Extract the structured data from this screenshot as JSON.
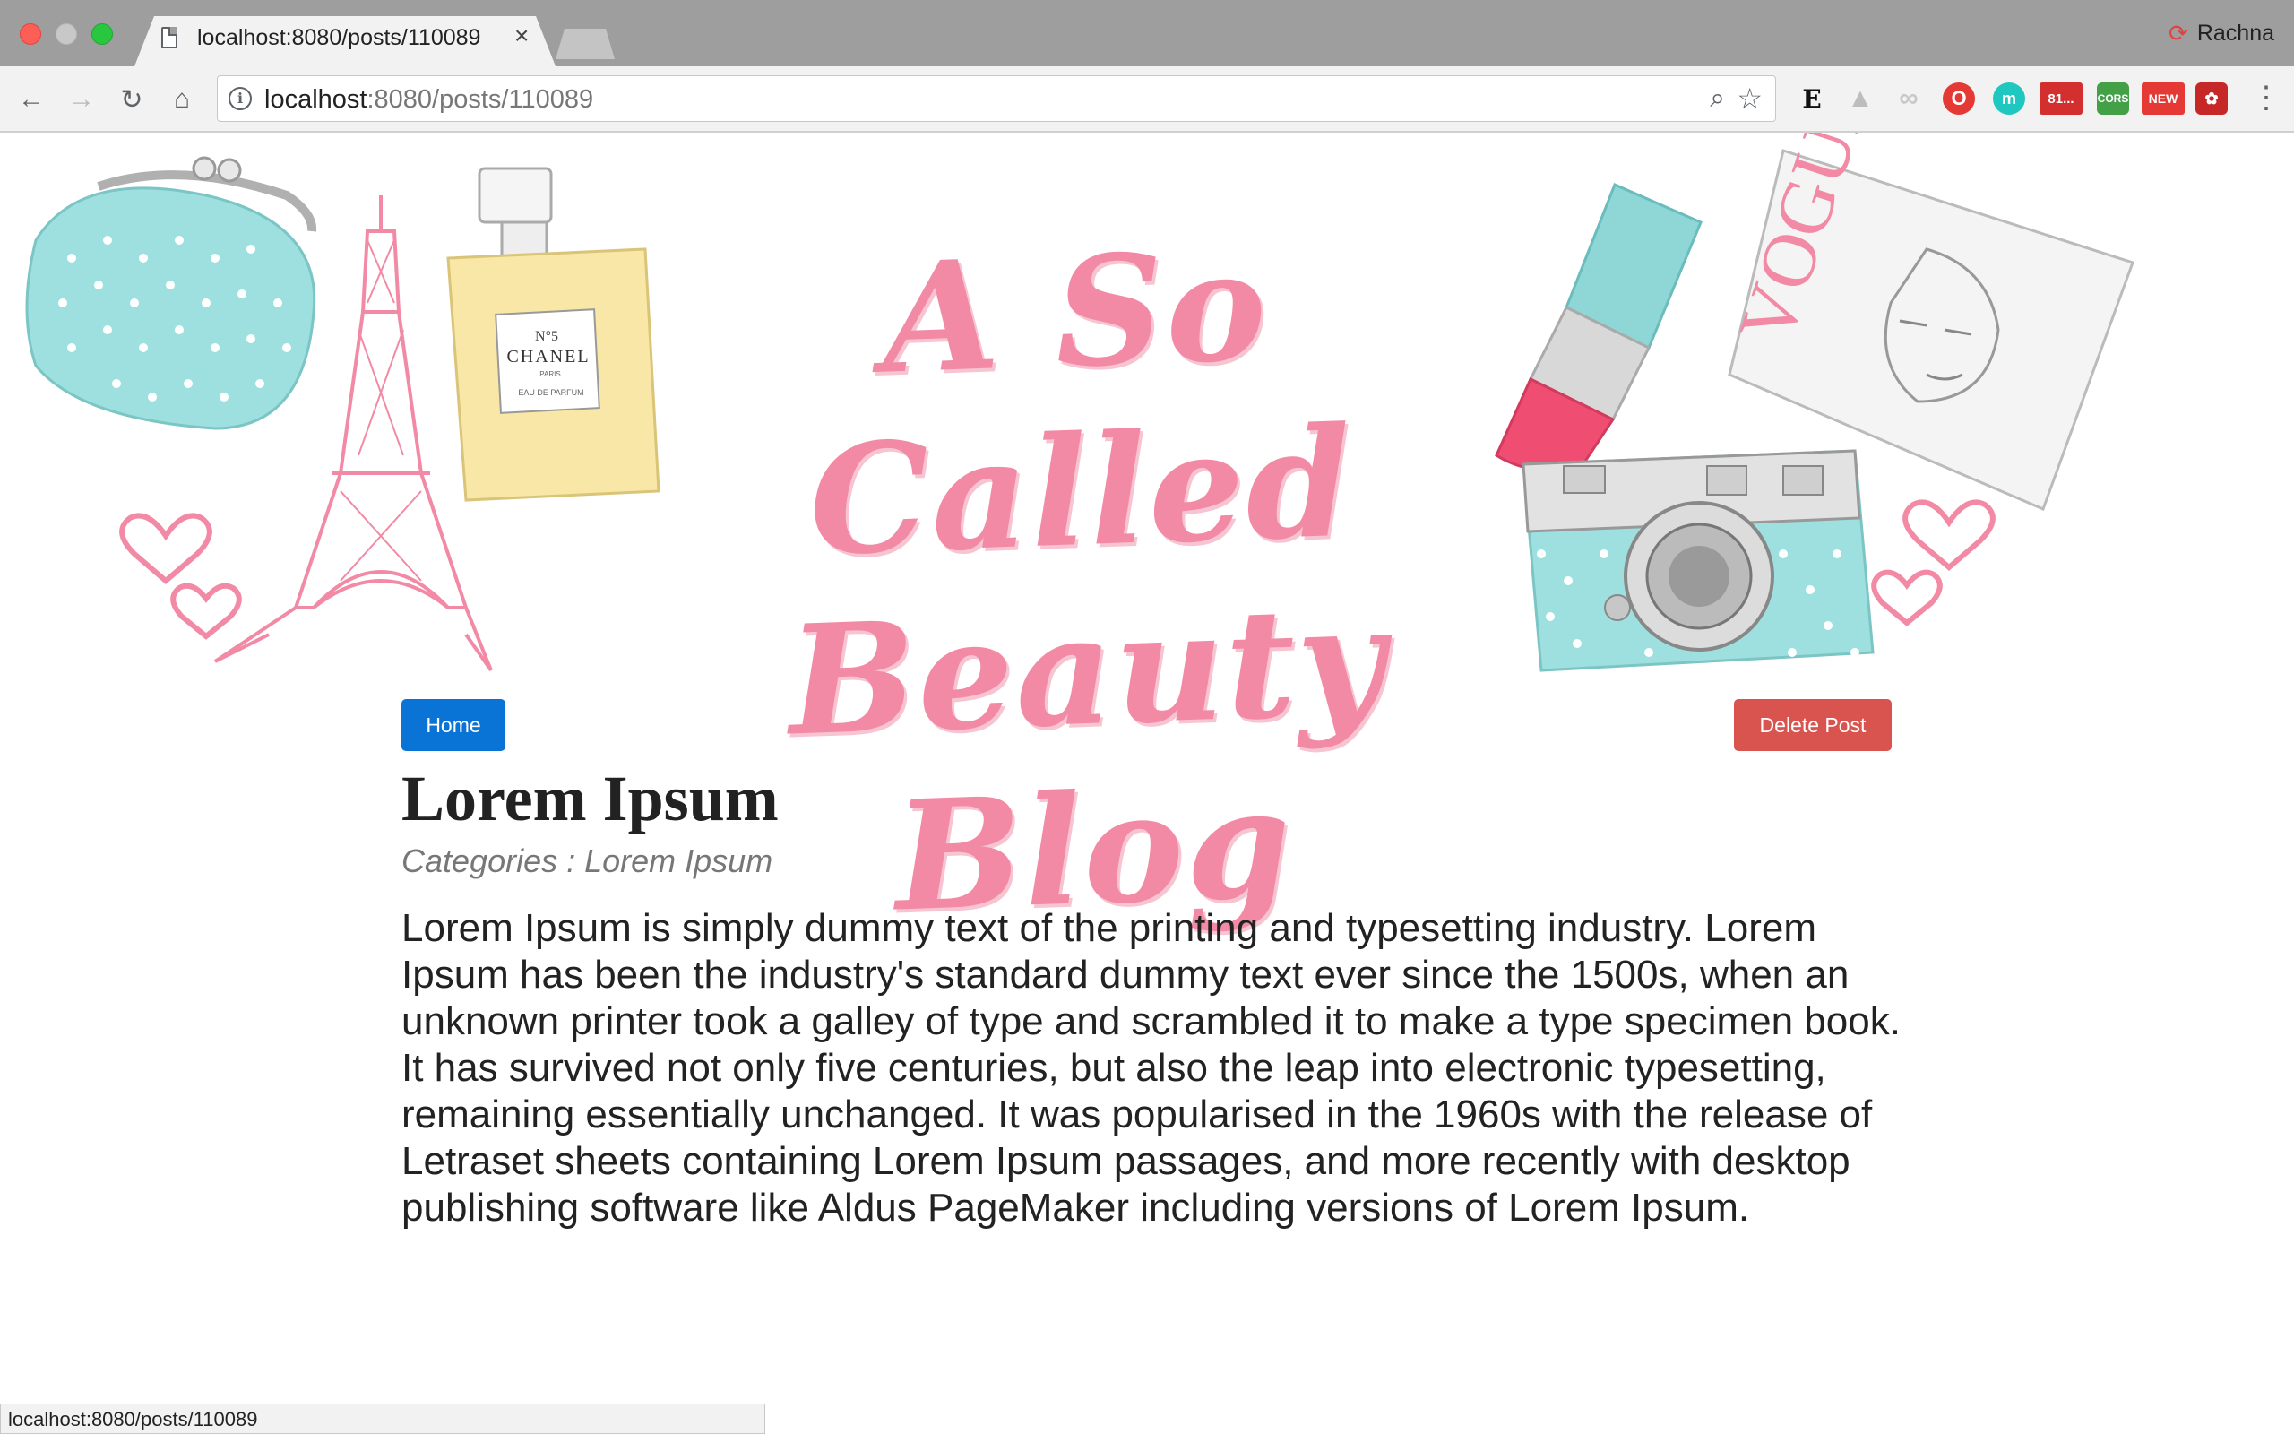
{
  "browser": {
    "tab_title": "localhost:8080/posts/110089",
    "tab_close": "×",
    "profile_name": "Rachna",
    "url_host": "localhost",
    "url_rest": ":8080/posts/110089",
    "extensions": {
      "ext6_badge": "81...",
      "ext7_badge": "CORS",
      "ext8_badge": "NEW"
    },
    "status_url": "localhost:8080/posts/110089"
  },
  "banner": {
    "title_line1": "A So Called",
    "title_line2": "Beauty Blog",
    "perfume_label_line1": "N°5",
    "perfume_label_line2": "CHANEL",
    "perfume_label_line3": "PARIS",
    "perfume_label_line4": "EAU DE PARFUM",
    "magazine_title": "VOGUE"
  },
  "actions": {
    "home_label": "Home",
    "delete_label": "Delete Post"
  },
  "post": {
    "title": "Lorem Ipsum",
    "categories": "Categories : Lorem Ipsum",
    "body": "Lorem Ipsum is simply dummy text of the printing and typesetting industry. Lorem Ipsum has been the industry's standard dummy text ever since the 1500s, when an unknown printer took a galley of type and scrambled it to make a type specimen book. It has survived not only five centuries, but also the leap into electronic typesetting, remaining essentially unchanged. It was popularised in the 1960s with the release of Letraset sheets containing Lorem Ipsum passages, and more recently with desktop publishing software like Aldus PageMaker including versions of Lorem Ipsum."
  },
  "colors": {
    "home_button": "#0a74d6",
    "delete_button": "#d9534f",
    "banner_pink": "#f28aa5",
    "banner_mint": "#9ee0e0"
  }
}
